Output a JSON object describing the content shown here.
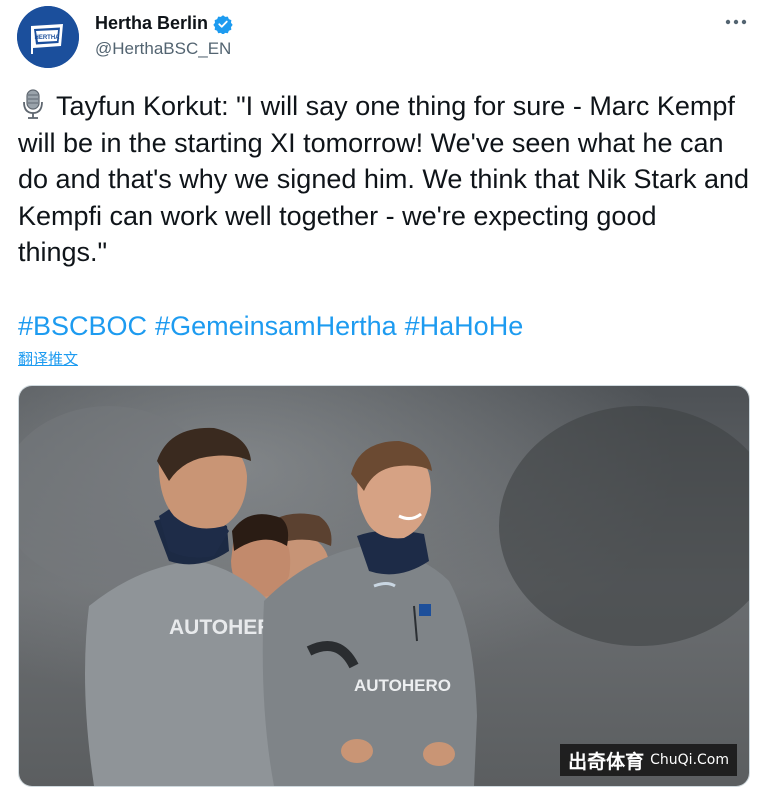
{
  "author": {
    "display_name": "Hertha Berlin",
    "handle": "@HerthaBSC_EN",
    "verified": true,
    "avatar_icon": "hertha-flag-logo",
    "brand_color": "#1b4f9c"
  },
  "tweet": {
    "text": "Tayfun Korkut: \"I will say one thing for sure - Marc Kempf will be in the starting XI tomorrow! We've seen what he can do and that's why we signed him. We think that Nik Stark and Kempfi can work well together - we're expecting good things.\"",
    "hashtags": [
      "#BSCBOC",
      "#GemeinsamHertha",
      "#HaHoHe"
    ],
    "translate_label": "翻译推文"
  },
  "media": {
    "sponsor_text": "AUTOHERO"
  },
  "watermark": {
    "cn": "出奇体育",
    "en": "ChuQi.Com"
  },
  "colors": {
    "link": "#1d9bf0",
    "text": "#0f1419",
    "muted": "#536471"
  }
}
